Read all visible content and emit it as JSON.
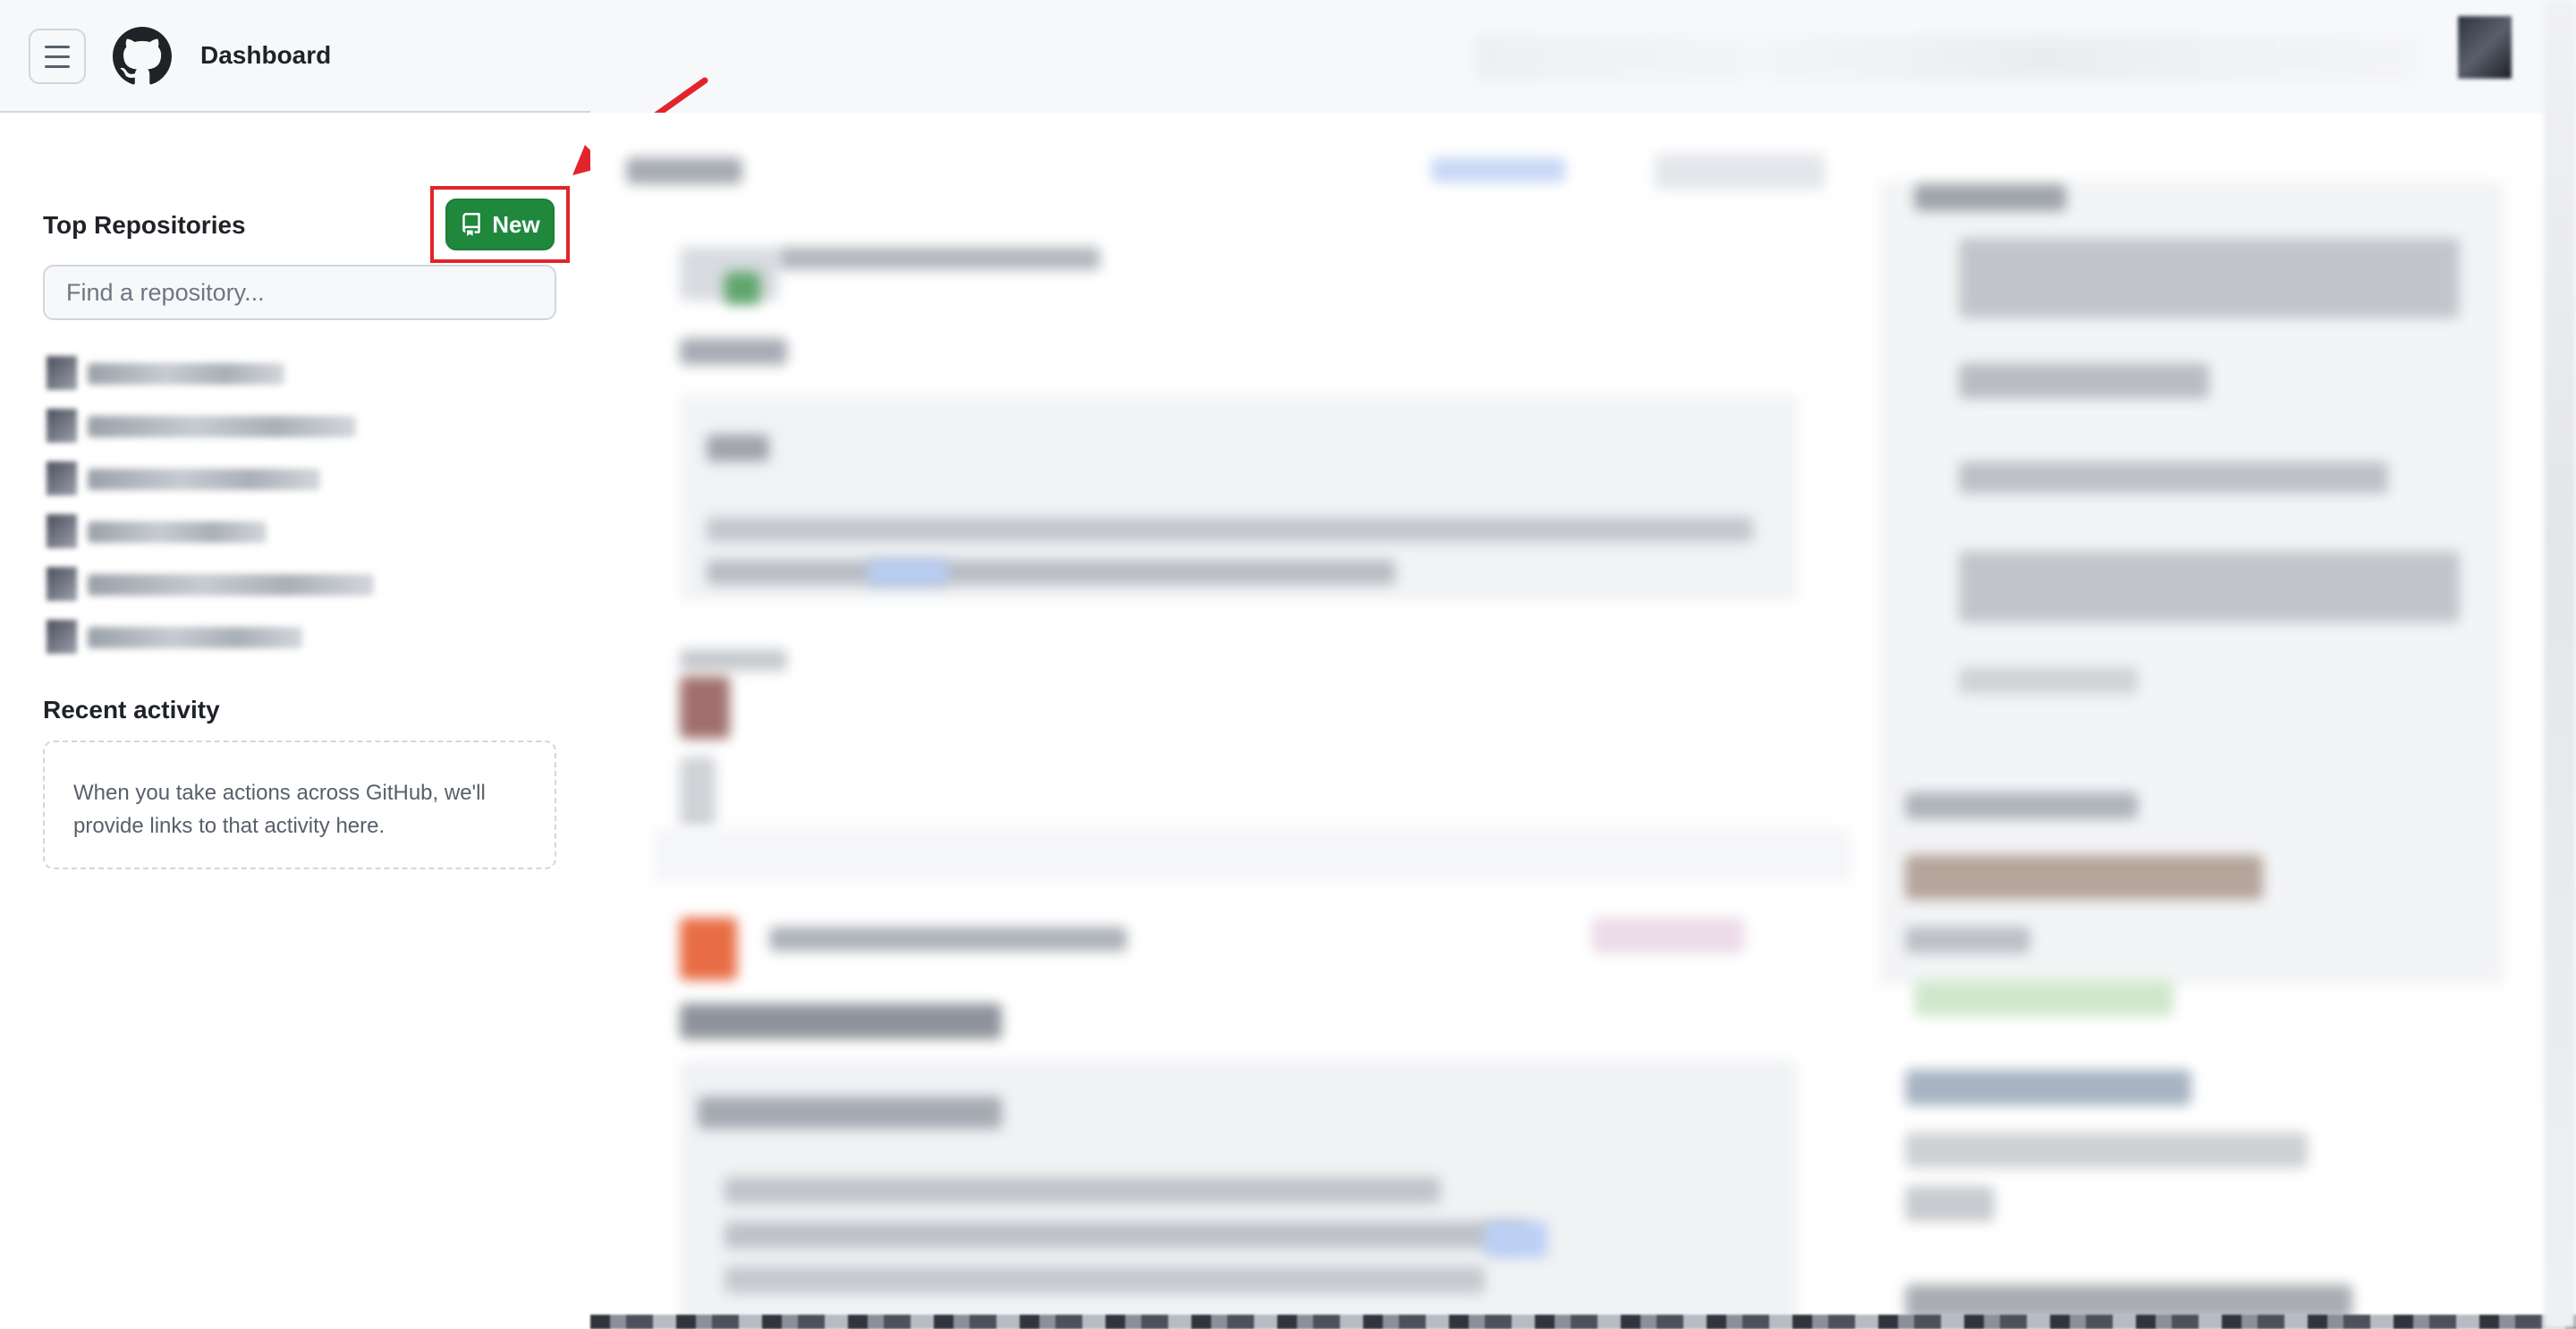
{
  "header": {
    "title": "Dashboard",
    "menu_icon": "hamburger-menu-icon",
    "logo_icon": "github-logo-icon"
  },
  "sidebar": {
    "top_repositories_title": "Top Repositories",
    "new_button_label": "New",
    "new_button_icon": "repo-icon",
    "search_placeholder": "Find a repository...",
    "recent_activity_title": "Recent activity",
    "recent_activity_text": "When you take actions across GitHub, we'll provide links to that activity here."
  },
  "colors": {
    "new_button_bg": "#1f883d",
    "highlight_box": "#e3242b",
    "annotation_arrow": "#e3242b"
  }
}
